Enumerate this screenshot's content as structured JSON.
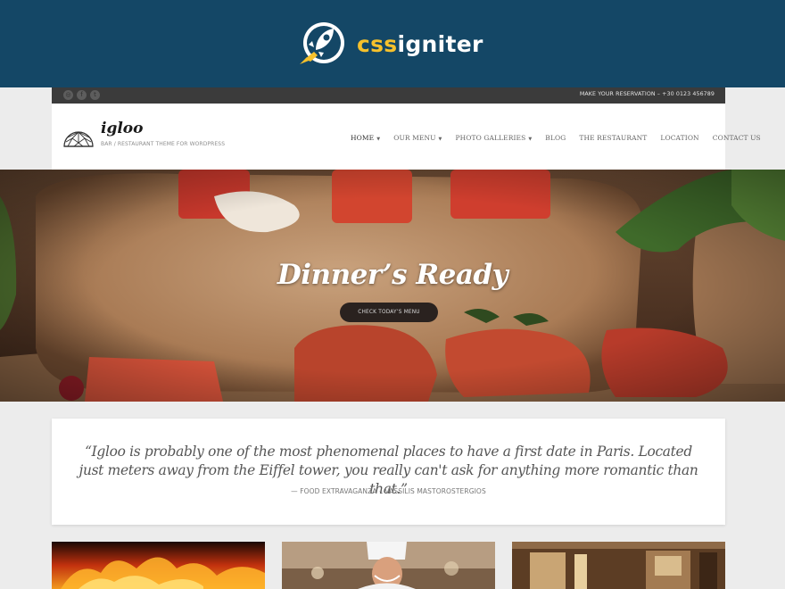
{
  "brand": {
    "prefix": "css",
    "suffix": "igniter",
    "logo_icon": "rocket-icon"
  },
  "topbar": {
    "social_icons": [
      "instagram-icon",
      "facebook-icon",
      "twitter-icon"
    ],
    "reservation": "MAKE YOUR RESERVATION – +30 0123 456789"
  },
  "header": {
    "logo_icon": "igloo-dome-icon",
    "title": "igloo",
    "tagline": "BAR / RESTAURANT THEME FOR WORDPRESS"
  },
  "nav": {
    "items": [
      {
        "label": "HOME",
        "dropdown": true,
        "active": true
      },
      {
        "label": "OUR MENU",
        "dropdown": true
      },
      {
        "label": "PHOTO GALLERIES",
        "dropdown": true
      },
      {
        "label": "BLOG",
        "dropdown": false
      },
      {
        "label": "THE RESTAURANT",
        "dropdown": false
      },
      {
        "label": "LOCATION",
        "dropdown": false
      },
      {
        "label": "CONTACT US",
        "dropdown": false
      }
    ]
  },
  "hero": {
    "title": "Dinner’s Ready",
    "button": "CHECK TODAY’S MENU"
  },
  "testimonial": {
    "quote": "“Igloo is probably one of the most phenomenal places to have a first date in Paris. Located just meters away from the Eiffel tower, you really can't ask for anything more romantic than that.”",
    "cite": "— FOOD EXTRAVAGANZA – VASSILIS MASTOROSTERGIOS"
  },
  "colors": {
    "brand_bar": "#144766",
    "brand_accent": "#f6c12c",
    "topbar": "#3b3b3b",
    "hero_button": "#2a221f"
  }
}
